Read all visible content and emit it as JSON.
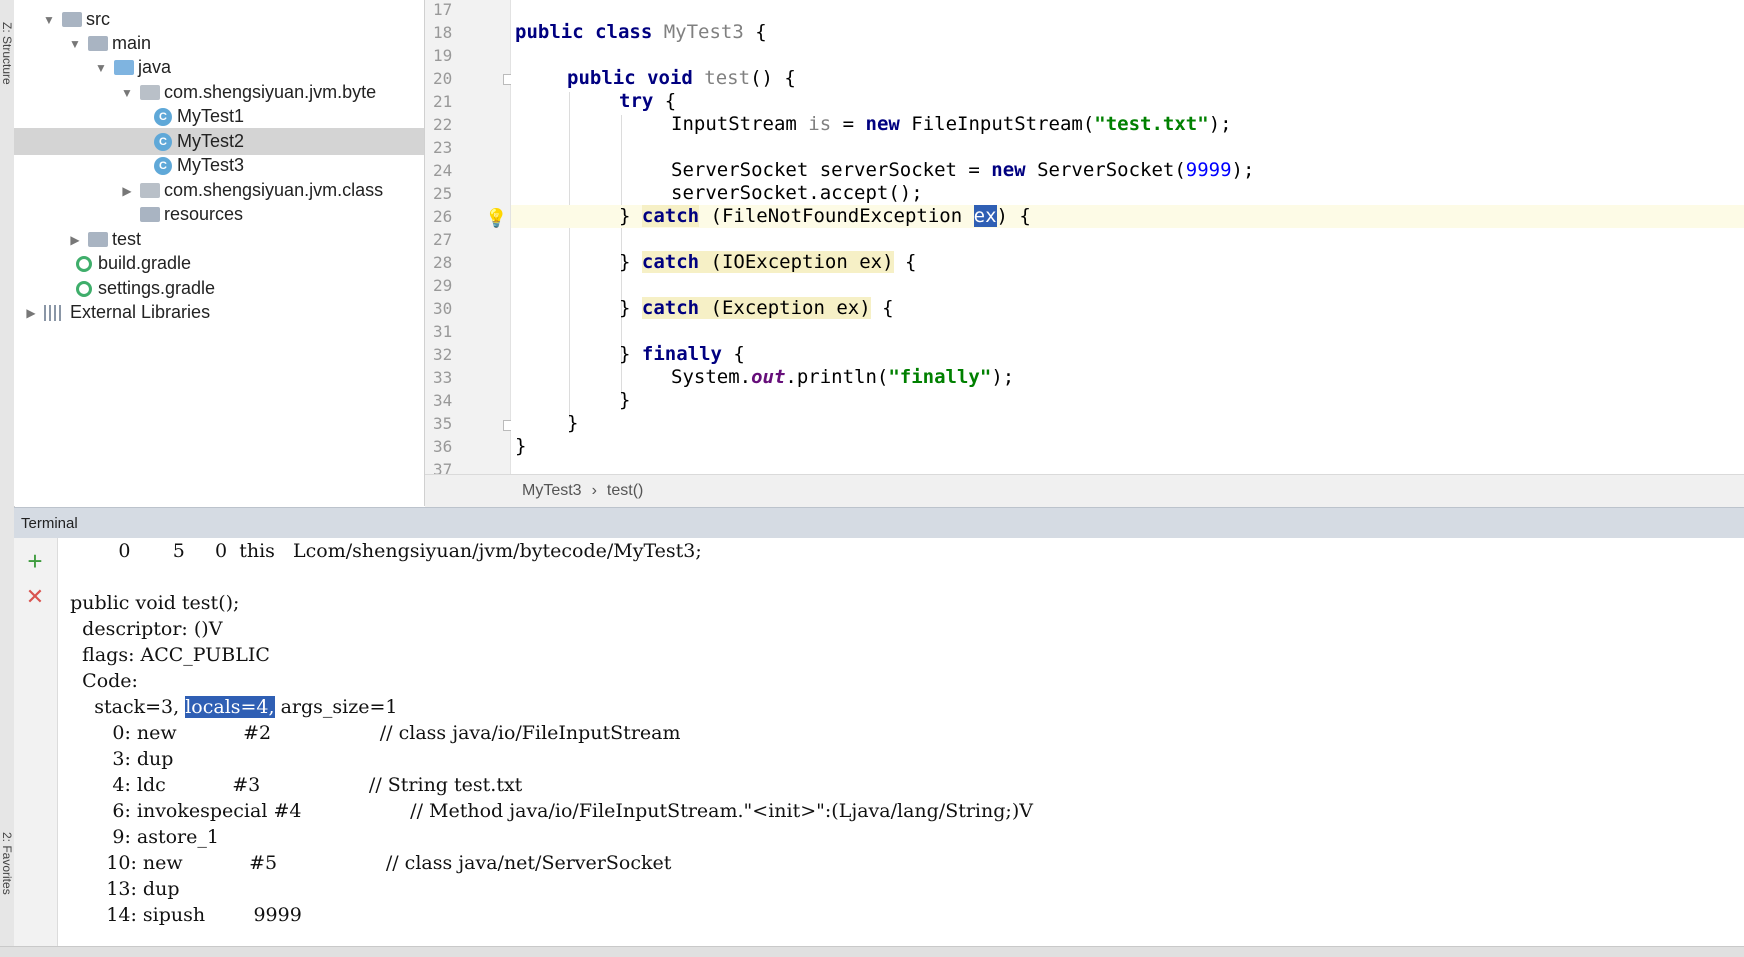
{
  "sidebar": {
    "structure_label": "Z: Structure",
    "favorites_label": "2: Favorites"
  },
  "tree": {
    "src": "src",
    "main": "main",
    "java": "java",
    "pkg_bytecode": "com.shengsiyuan.jvm.byte",
    "mytest1": "MyTest1",
    "mytest2": "MyTest2",
    "mytest3": "MyTest3",
    "pkg_class": "com.shengsiyuan.jvm.class",
    "resources": "resources",
    "test": "test",
    "build_gradle": "build.gradle",
    "settings_gradle": "settings.gradle",
    "external_libraries": "External Libraries"
  },
  "editor": {
    "line_numbers": [
      "17",
      "18",
      "19",
      "20",
      "21",
      "22",
      "23",
      "24",
      "25",
      "26",
      "27",
      "28",
      "29",
      "30",
      "31",
      "32",
      "33",
      "34",
      "35",
      "36",
      "37"
    ],
    "l18_kw": "public class",
    "l18_name": "MyTest3",
    "l18_tail": " {",
    "l20_kw": "public void",
    "l20_name": "test",
    "l20_tail": "() {",
    "l21_kw": "try",
    "l21_tail": " {",
    "l22_a": "InputStream ",
    "l22_var": "is",
    "l22_b": " = ",
    "l22_kw": "new",
    "l22_c": " FileInputStream(",
    "l22_str": "\"test.txt\"",
    "l22_d": ");",
    "l24_a": "ServerSocket serverSocket = ",
    "l24_kw": "new",
    "l24_b": " ServerSocket(",
    "l24_num": "9999",
    "l24_c": ");",
    "l25_a": "serverSocket.accept();",
    "l26_a": "} ",
    "l26_kw": "catch",
    "l26_b": " (FileNotFoundException ",
    "l26_sel": "ex",
    "l26_c": ") {",
    "l28_a": "} ",
    "l28_kw": "catch",
    "l28_b": " (IOException ex)",
    "l28_c": " {",
    "l30_a": "} ",
    "l30_kw": "catch",
    "l30_b": " (Exception ex)",
    "l30_c": " {",
    "l32_a": "} ",
    "l32_kw": "finally",
    "l32_b": " {",
    "l33_a": "System.",
    "l33_out": "out",
    "l33_b": ".println(",
    "l33_str": "\"finally\"",
    "l33_c": ");",
    "l34_a": "}",
    "l35_a": "}",
    "l36_a": "}"
  },
  "breadcrumb": {
    "class": "MyTest3",
    "sep": "›",
    "method": "test()"
  },
  "terminal": {
    "title": "Terminal",
    "add_icon": "+",
    "close_icon": "✕",
    "lines": {
      "l0": "          0       5     0  this   Lcom/shengsiyuan/jvm/bytecode/MyTest3;",
      "l1": "  public void test();",
      "l2": "    descriptor: ()V",
      "l3": "    flags: ACC_PUBLIC",
      "l4": "    Code:",
      "l5_a": "      stack=3, ",
      "l5_sel": "locals=4,",
      "l5_b": " args_size=1",
      "l6": "         0: new           #2                  // class java/io/FileInputStream",
      "l7": "         3: dup",
      "l8": "         4: ldc           #3                  // String test.txt",
      "l9": "         6: invokespecial #4                  // Method java/io/FileInputStream.\"<init>\":(Ljava/lang/String;)V",
      "l10": "         9: astore_1",
      "l11": "        10: new           #5                  // class java/net/ServerSocket",
      "l12": "        13: dup",
      "l13": "        14: sipush        9999"
    }
  }
}
